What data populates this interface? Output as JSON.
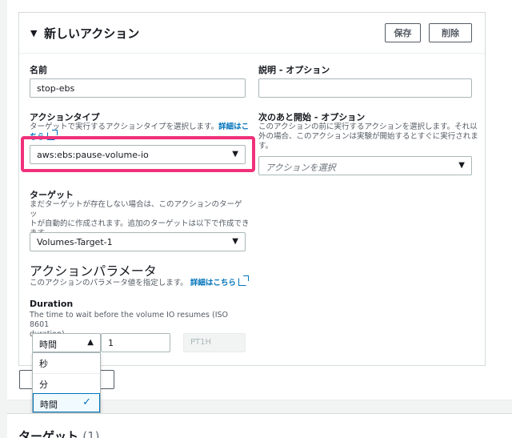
{
  "panel": {
    "title": "新しいアクション",
    "save_label": "保存",
    "delete_label": "削除"
  },
  "name": {
    "label": "名前",
    "value": "stop-ebs"
  },
  "description": {
    "label": "説明 - オプション",
    "value": ""
  },
  "action_type": {
    "label": "アクションタイプ",
    "desc_line1": "ターゲットで実行するアクションタイプを選択します。",
    "link_part1": "詳細はこ",
    "link_part2": "ちら",
    "value": "aws:ebs:pause-volume-io"
  },
  "start_after": {
    "label": "次のあと開始 - オプション",
    "desc_line1": "このアクションの前に実行するアクションを選択します。それ以",
    "desc_line2": "外の場合、このアクションは実験が開始するとすぐに実行されま",
    "desc_line3": "す。",
    "placeholder": "アクションを選択"
  },
  "target": {
    "label": "ターゲット",
    "desc_line1": "まだターゲットが存在しない場合は、このアクションのターゲッ",
    "desc_line2": "トが自動的に作成されます。追加のターゲットは以下で作成でき",
    "desc_line3": "ます。",
    "value": "Volumes-Target-1"
  },
  "params": {
    "title": "アクションパラメータ",
    "desc": "このアクションのパラメータ値を指定します。",
    "link": "詳細はこちら"
  },
  "duration": {
    "label": "Duration",
    "desc_line1": "The time to wait before the volume IO resumes (ISO 8601",
    "desc_line2": "duration).",
    "unit_value": "時間",
    "amount": "1",
    "iso_preview": "PT1H",
    "options": [
      "秒",
      "分",
      "時間"
    ]
  },
  "targets_section": {
    "title": "ターゲット",
    "count": "(1)"
  }
}
